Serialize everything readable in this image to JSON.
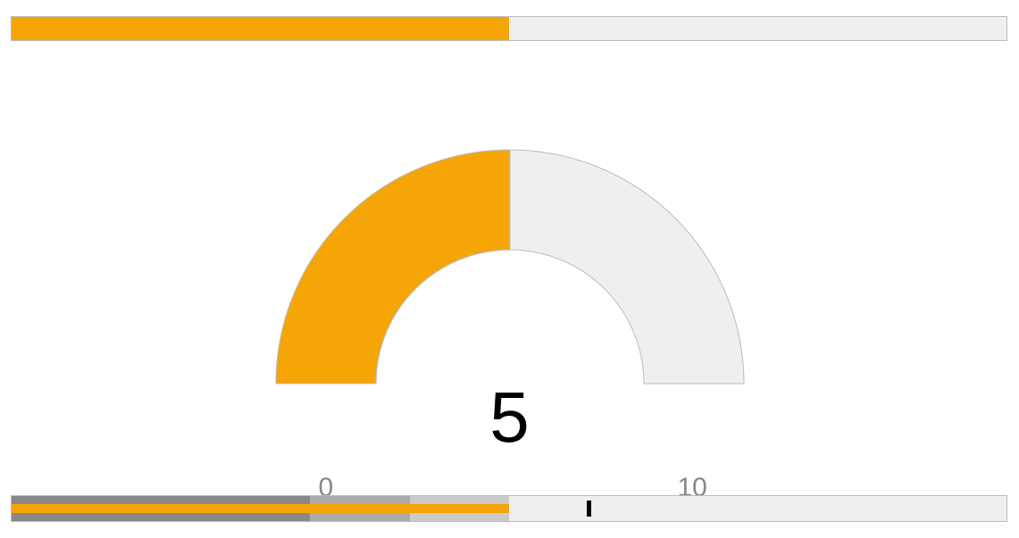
{
  "chart_data": [
    {
      "type": "bar",
      "name": "linear-gauge",
      "min": 0,
      "max": 10,
      "value": 5,
      "fill_color": "#F5A506",
      "track_color": "#EFEFEF"
    },
    {
      "type": "bar",
      "name": "radial-gauge",
      "min": 0,
      "max": 10,
      "value": 5,
      "value_label": "5",
      "min_label": "0",
      "max_label": "10",
      "fill_color": "#F5A506",
      "track_color": "#EFEFEF"
    },
    {
      "type": "bar",
      "name": "bullet-graph",
      "min": 0,
      "max": 10,
      "ranges": [
        3,
        4,
        5
      ],
      "value": 5,
      "target": 5.8,
      "range_colors": [
        "#888888",
        "#AAAAAA",
        "#CACACA"
      ],
      "bar_color": "#F5A506",
      "target_color": "#000000"
    }
  ],
  "labels": {
    "radial_value": "5",
    "radial_min": "0",
    "radial_max": "10"
  }
}
